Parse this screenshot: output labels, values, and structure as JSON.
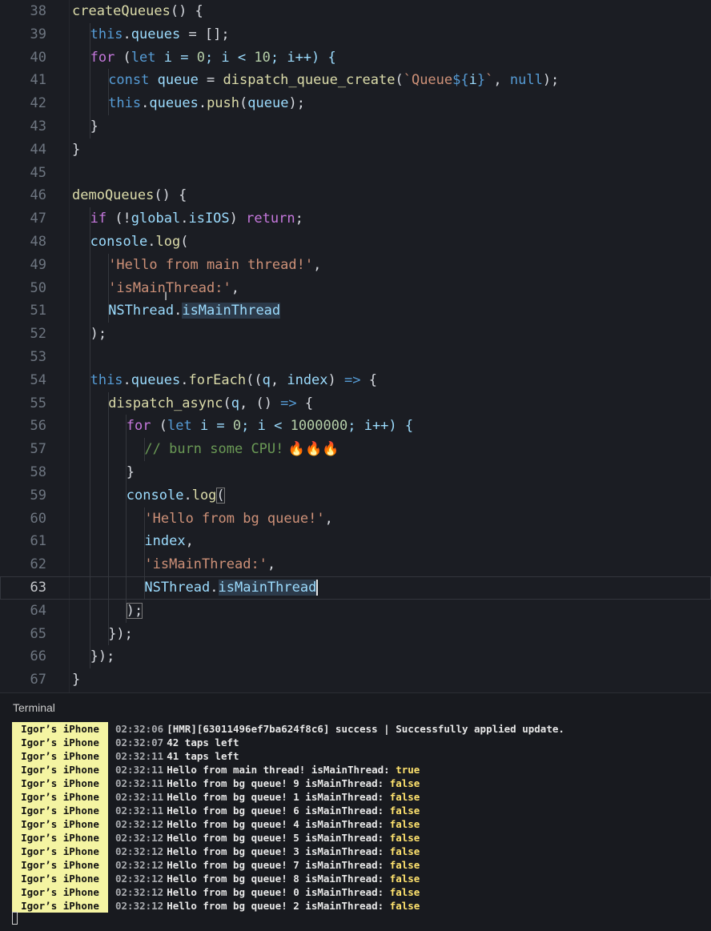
{
  "editor": {
    "line_numbers": [
      "38",
      "39",
      "40",
      "41",
      "42",
      "43",
      "44",
      "45",
      "46",
      "47",
      "48",
      "49",
      "50",
      "51",
      "52",
      "53",
      "54",
      "55",
      "56",
      "57",
      "58",
      "59",
      "60",
      "61",
      "62",
      "63",
      "64",
      "65",
      "66",
      "67"
    ],
    "active_line": "63"
  },
  "terminal": {
    "title": "Terminal",
    "device_label": "Igor’s iPhone",
    "entries": [
      {
        "time": "02:32:06",
        "message": "[HMR][63011496ef7ba624f8c6] success | Successfully applied update.",
        "value": ""
      },
      {
        "time": "02:32:07",
        "message": "42 taps left",
        "value": ""
      },
      {
        "time": "02:32:11",
        "message": "41 taps left",
        "value": ""
      },
      {
        "time": "02:32:11",
        "message": "Hello from main thread! isMainThread:",
        "value": "true"
      },
      {
        "time": "02:32:11",
        "message": "Hello from bg queue! 9 isMainThread:",
        "value": "false"
      },
      {
        "time": "02:32:11",
        "message": "Hello from bg queue! 1 isMainThread:",
        "value": "false"
      },
      {
        "time": "02:32:11",
        "message": "Hello from bg queue! 6 isMainThread:",
        "value": "false"
      },
      {
        "time": "02:32:12",
        "message": "Hello from bg queue! 4 isMainThread:",
        "value": "false"
      },
      {
        "time": "02:32:12",
        "message": "Hello from bg queue! 5 isMainThread:",
        "value": "false"
      },
      {
        "time": "02:32:12",
        "message": "Hello from bg queue! 3 isMainThread:",
        "value": "false"
      },
      {
        "time": "02:32:12",
        "message": "Hello from bg queue! 7 isMainThread:",
        "value": "false"
      },
      {
        "time": "02:32:12",
        "message": "Hello from bg queue! 8 isMainThread:",
        "value": "false"
      },
      {
        "time": "02:32:12",
        "message": "Hello from bg queue! 0 isMainThread:",
        "value": "false"
      },
      {
        "time": "02:32:12",
        "message": "Hello from bg queue! 2 isMainThread:",
        "value": "false"
      }
    ]
  },
  "code": {
    "l38": {
      "fn": "createQueues",
      "p": "() {"
    },
    "l39": {
      "this": "this",
      "dot": ".",
      "prop": "queues",
      "rest": " = [];"
    },
    "l40": {
      "for": "for",
      "open": " (",
      "let": "let",
      "i1": " i = ",
      "n0": "0",
      "i2": "; i < ",
      "n10": "10",
      "i3": "; i++) {"
    },
    "l41": {
      "const": "const",
      "sp": " ",
      "var": "queue",
      "eq": " = ",
      "fn": "dispatch_queue_create",
      "po": "(",
      "tpl1": "`Queue",
      "tplo": "${",
      "ti": "i",
      "tplc": "}",
      "tpl2": "`",
      "comma": ", ",
      "null": "null",
      "end": ");"
    },
    "l42": {
      "this": "this",
      "dot": ".",
      "prop": "queues",
      "dot2": ".",
      "fn": "push",
      "po": "(",
      "arg": "queue",
      "end": ");"
    },
    "l43": {
      "t": "}"
    },
    "l44": {
      "t": "}"
    },
    "l46": {
      "fn": "demoQueues",
      "p": "() {"
    },
    "l47": {
      "if": "if",
      "o": " (!",
      "g": "global",
      "dot": ".",
      "p": "isIOS",
      "c": ") ",
      "ret": "return",
      "s": ";"
    },
    "l48": {
      "obj": "console",
      "dot": ".",
      "fn": "log",
      "p": "("
    },
    "l49": {
      "s": "'Hello from main thread!'",
      "c": ","
    },
    "l50": {
      "s": "'isMainThread:'",
      "c": ","
    },
    "l51": {
      "cls": "NSThread",
      "dot": ".",
      "prop": "isMainThread"
    },
    "l52": {
      "t": ");"
    },
    "l54": {
      "this": "this",
      "dot": ".",
      "prop": "queues",
      "dot2": ".",
      "fn": "forEach",
      "po": "((",
      "a1": "q",
      "cm": ", ",
      "a2": "index",
      "pc": ") ",
      "arrow": "=>",
      "b": " {"
    },
    "l55": {
      "fn": "dispatch_async",
      "po": "(",
      "a": "q",
      "cm": ", () ",
      "arrow": "=>",
      "b": " {"
    },
    "l56": {
      "for": "for",
      "open": " (",
      "let": "let",
      "i1": " i = ",
      "n0": "0",
      "i2": "; i < ",
      "n": "1000000",
      "i3": "; i++) {"
    },
    "l57": {
      "comment": "// burn some CPU!",
      "emoji": "🔥🔥🔥"
    },
    "l58": {
      "t": "}"
    },
    "l59": {
      "obj": "console",
      "dot": ".",
      "fn": "log",
      "p": "("
    },
    "l60": {
      "s": "'Hello from bg queue!'",
      "c": ","
    },
    "l61": {
      "v": "index",
      "c": ","
    },
    "l62": {
      "s": "'isMainThread:'",
      "c": ","
    },
    "l63": {
      "cls": "NSThread",
      "dot": ".",
      "prop": "isMainThread"
    },
    "l64": {
      "t": ");"
    },
    "l65": {
      "t": "});"
    },
    "l66": {
      "t": "});"
    },
    "l67": {
      "t": "}"
    }
  }
}
